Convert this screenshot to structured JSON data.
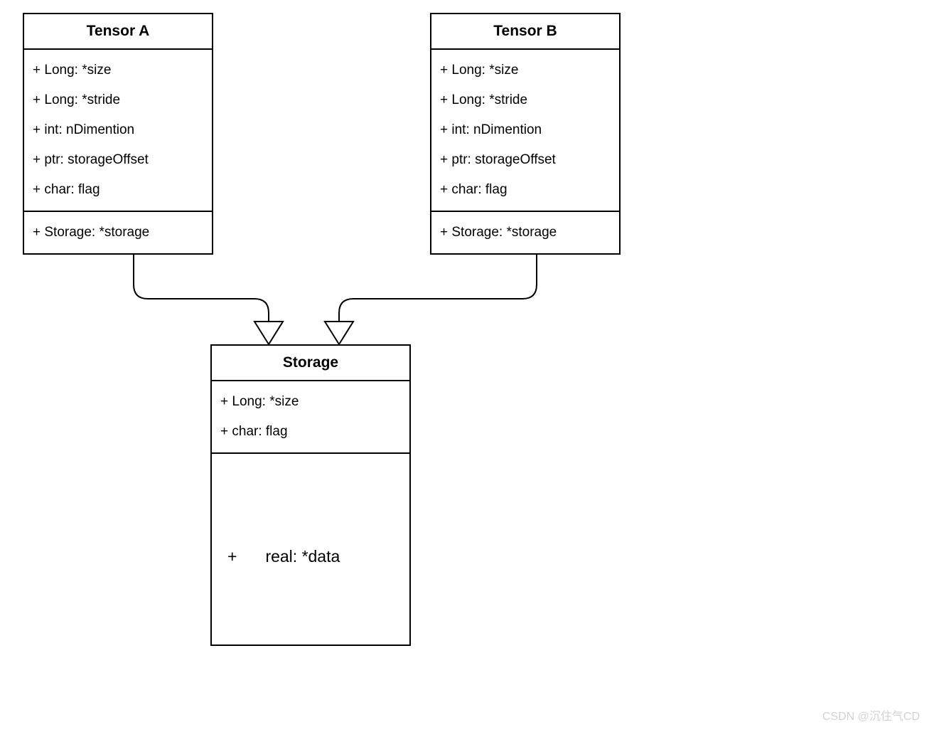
{
  "tensor_a": {
    "title": "Tensor A",
    "attrs": [
      "+ Long: *size",
      "+ Long: *stride",
      "+ int:  nDimention",
      "+ ptr: storageOffset",
      "+ char: flag"
    ],
    "bottom": "+ Storage: *storage"
  },
  "tensor_b": {
    "title": "Tensor B",
    "attrs": [
      "+ Long: *size",
      "+ Long: *stride",
      "+ int:  nDimention",
      "+ ptr: storageOffset",
      "+ char: flag"
    ],
    "bottom": "+ Storage: *storage"
  },
  "storage": {
    "title": "Storage",
    "attrs": [
      "+ Long: *size",
      "+ char: flag"
    ],
    "data_plus": "+",
    "data_label": "real: *data"
  },
  "watermark": "CSDN @沉住气CD"
}
